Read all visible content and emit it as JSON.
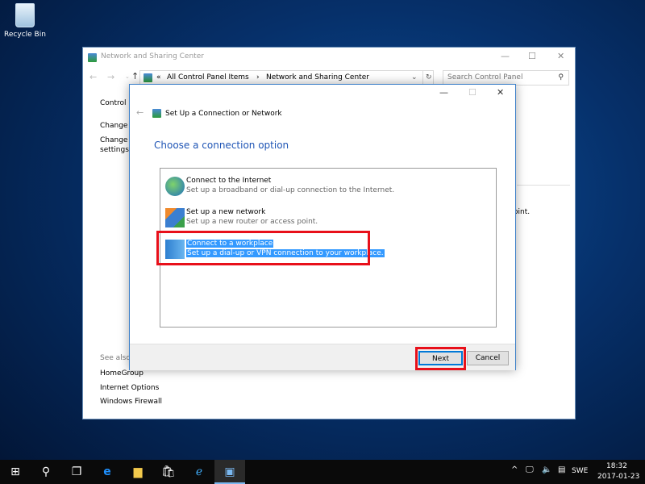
{
  "desktop": {
    "recycle_bin": "Recycle Bin"
  },
  "main_window": {
    "title": "Network and Sharing Center",
    "breadcrumb": [
      "«",
      "All Control Panel Items",
      "›",
      "Network and Sharing Center"
    ],
    "search_placeholder": "Search Control Panel",
    "left_pane": [
      "Control P",
      "Change a",
      "Change a",
      "settings"
    ],
    "right_fragment": "oint.",
    "see_also_label": "See also",
    "see_also": [
      "HomeGroup",
      "Internet Options",
      "Windows Firewall"
    ]
  },
  "dialog": {
    "title": "Set Up a Connection or Network",
    "heading": "Choose a connection option",
    "options": [
      {
        "title": "Connect to the Internet",
        "desc": "Set up a broadband or dial-up connection to the Internet.",
        "icon": "globe-icon"
      },
      {
        "title": "Set up a new network",
        "desc": "Set up a new router or access point.",
        "icon": "router-icon"
      },
      {
        "title": "Connect to a workplace",
        "desc": "Set up a dial-up or VPN connection to your workplace.",
        "icon": "workplace-icon",
        "selected": true
      }
    ],
    "next": "Next",
    "cancel": "Cancel"
  },
  "taskbar": {
    "language": "SWE",
    "time": "18:32",
    "date": "2017-01-23"
  },
  "colors": {
    "highlight": "#3399ff",
    "annotation": "#e8101a",
    "heading": "#1f55b5"
  }
}
